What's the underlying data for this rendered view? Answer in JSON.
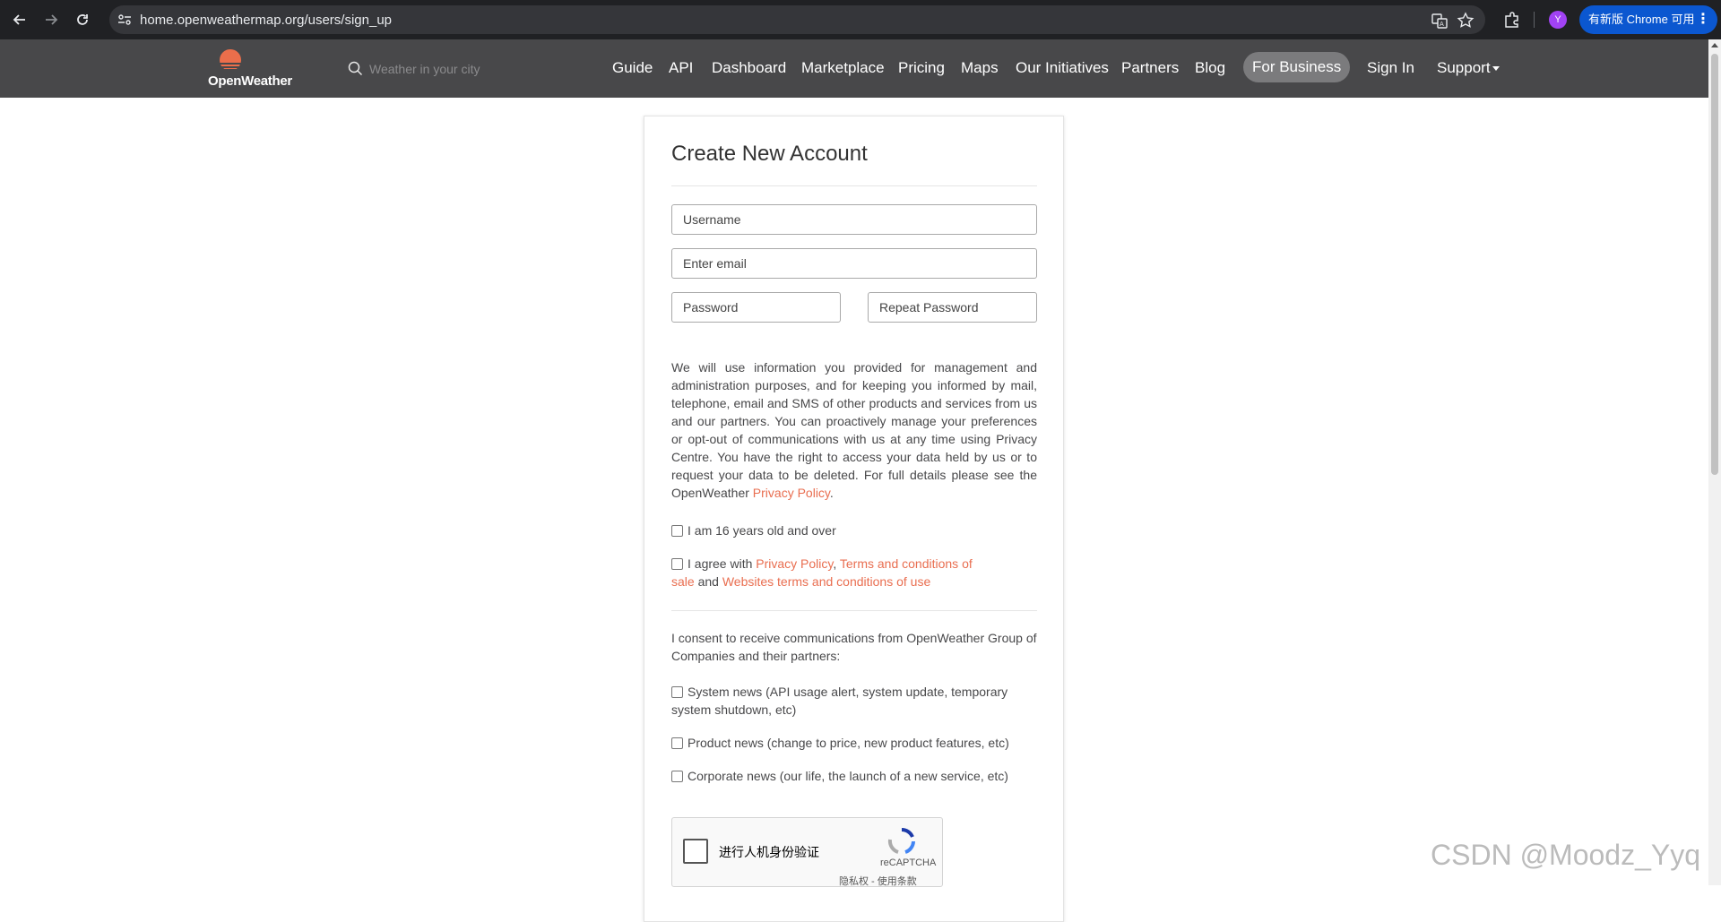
{
  "browser": {
    "url": "home.openweathermap.org/users/sign_up",
    "profile_initial": "Y",
    "update_label": "有新版 Chrome 可用"
  },
  "header": {
    "brand": "OpenWeather",
    "search_placeholder": "Weather in your city",
    "menu": [
      "Guide",
      "API",
      "Dashboard",
      "Marketplace",
      "Pricing",
      "Maps",
      "Our Initiatives",
      "Partners",
      "Blog",
      "For Business",
      "Sign In",
      "Support"
    ]
  },
  "form": {
    "title": "Create New Account",
    "username_placeholder": "Username",
    "email_placeholder": "Enter email",
    "password_placeholder": "Password",
    "repeat_password_placeholder": "Repeat Password",
    "policy_text": "We will use information you provided for management and administration purposes, and for keeping you informed by mail, telephone, email and SMS of other products and services from us and our partners. You can proactively manage your preferences or opt-out of communications with us at any time using Privacy Centre. You have the right to access your data held by us or to request your data to be deleted. For full details please see the OpenWeather",
    "policy_link": "Privacy Policy",
    "policy_end": ".",
    "age_label": "I am 16 years old and over",
    "agree_prefix": "I agree with",
    "agree_link1": "Privacy Policy",
    "agree_comma": ",",
    "agree_link2": "Terms and conditions of sale",
    "agree_and": "and",
    "agree_link3": "Websites terms and conditions of use",
    "consent_text": "I consent to receive communications from OpenWeather Group of Companies and their partners:",
    "system_news": "System news (API usage alert, system update, temporary system shutdown, etc)",
    "product_news": "Product news (change to price, new product features, etc)",
    "corporate_news": "Corporate news (our life, the launch of a new service, etc)",
    "recaptcha_label": "进行人机身份验证",
    "recaptcha_brand": "reCAPTCHA",
    "recaptcha_terms": "隐私权 - 使用条款"
  },
  "watermark": "CSDN @Moodz_Yyq",
  "colors": {
    "header_bg": "#48484a",
    "link": "#e96e50",
    "brand_orange": "#eb6e4b"
  }
}
